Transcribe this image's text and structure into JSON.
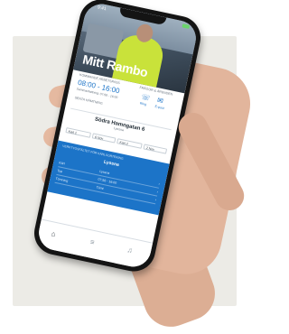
{
  "app": {
    "title": "Mitt Rambo",
    "status_time": "9:41"
  },
  "shift": {
    "label": "KOMMANDE ARBETSPASS",
    "time_range": "08:00 - 16:00",
    "note": "Sammanfattning: 07:58 - 16:00",
    "extra_label": "SENTA HÄMTNING"
  },
  "contact": {
    "label": "FRÅGOR & ÄRENDEN",
    "call_label": "Ring",
    "mail_label": "E-post",
    "call_icon": "phone-icon",
    "mail_icon": "mail-icon"
  },
  "location": {
    "name": "Södra Hamngatan 6",
    "sub": "Lyssna"
  },
  "tags": [
    {
      "label": "Kärl 1",
      "value": "6 Nov"
    },
    {
      "label": "Kärl 2",
      "value": "2 Nov"
    }
  ],
  "panel": {
    "header": "VERKTYGSFÄLTET FÖR KÄRLSORTERING",
    "title": "Lyssna",
    "rows": [
      {
        "key": "Kärl",
        "value": "Lyssna",
        "chevron": "›"
      },
      {
        "key": "Typ",
        "value": "07:56 - 16:00",
        "chevron": "›"
      },
      {
        "key": "Tömning",
        "value": "Tömt",
        "chevron": "›"
      }
    ]
  },
  "tabbar": {
    "items": [
      {
        "icon": "home-icon",
        "glyph": "⌂"
      },
      {
        "icon": "list-icon",
        "glyph": "≡"
      },
      {
        "icon": "bell-icon",
        "glyph": "♫"
      }
    ]
  },
  "colors": {
    "accent": "#1c74c8",
    "background_card": "#ecebe6"
  }
}
